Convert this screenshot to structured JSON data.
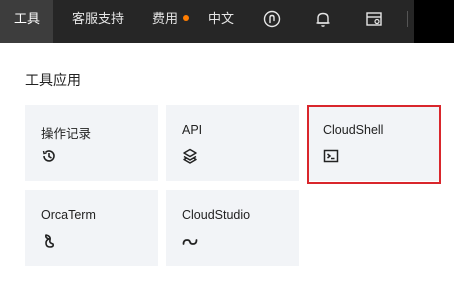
{
  "topbar": {
    "tools_label": "工具",
    "support_label": "客服支持",
    "billing_label": "费用",
    "language_label": "中文",
    "icons": [
      "sync-icon",
      "bell-icon",
      "settings-panel-icon"
    ],
    "accent_color": "#ff7d00"
  },
  "panel": {
    "title": "工具应用",
    "cards": [
      {
        "label": "操作记录",
        "icon": "history-icon"
      },
      {
        "label": "API",
        "icon": "api-icon"
      },
      {
        "label": "CloudShell",
        "icon": "terminal-icon"
      },
      {
        "label": "OrcaTerm",
        "icon": "orcaterm-icon"
      },
      {
        "label": "CloudStudio",
        "icon": "cloudstudio-icon"
      }
    ],
    "highlight_color": "#d9262c"
  }
}
